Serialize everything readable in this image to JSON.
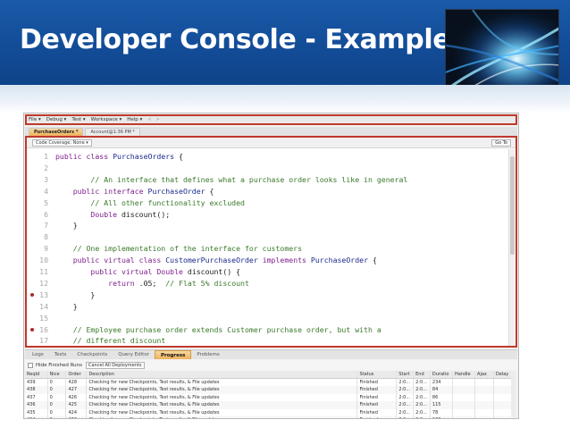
{
  "slide": {
    "title": "Developer Console - Example"
  },
  "colors": {
    "header_blue": "#124b96",
    "highlight_red": "#c0392b",
    "active_tab_orange": "#efb25c"
  },
  "menubar": {
    "items": [
      "File ▾",
      "Debug ▾",
      "Test ▾",
      "Workspace ▾",
      "Help ▾"
    ],
    "nav": [
      "<",
      ">"
    ]
  },
  "file_tabs": [
    "PurchaseOrders *",
    "Account@1:36 PM *"
  ],
  "editor": {
    "coverage": "Code Coverage: None ▾",
    "goto": "Go To",
    "lines": [
      {
        "n": "1",
        "marker": false,
        "parts": [
          [
            "kw",
            "public class "
          ],
          [
            "tp",
            "PurchaseOrders "
          ],
          [
            "pl",
            "{"
          ]
        ]
      },
      {
        "n": "2",
        "marker": false,
        "parts": []
      },
      {
        "n": "3",
        "marker": false,
        "parts": [
          [
            "cm",
            "        // An interface that defines what a purchase order looks like in general"
          ]
        ]
      },
      {
        "n": "4",
        "marker": false,
        "parts": [
          [
            "kw",
            "    public interface "
          ],
          [
            "tp",
            "PurchaseOrder "
          ],
          [
            "pl",
            "{"
          ]
        ]
      },
      {
        "n": "5",
        "marker": false,
        "parts": [
          [
            "cm",
            "        // All other functionality excluded"
          ]
        ]
      },
      {
        "n": "6",
        "marker": false,
        "parts": [
          [
            "kw",
            "        Double "
          ],
          [
            "pl",
            "discount();"
          ]
        ]
      },
      {
        "n": "7",
        "marker": false,
        "parts": [
          [
            "pl",
            "    }"
          ]
        ]
      },
      {
        "n": "8",
        "marker": false,
        "parts": []
      },
      {
        "n": "9",
        "marker": false,
        "parts": [
          [
            "cm",
            "    // One implementation of the interface for customers"
          ]
        ]
      },
      {
        "n": "10",
        "marker": false,
        "parts": [
          [
            "kw",
            "    public virtual class "
          ],
          [
            "tp",
            "CustomerPurchaseOrder "
          ],
          [
            "kw",
            "implements "
          ],
          [
            "tp",
            "PurchaseOrder "
          ],
          [
            "pl",
            "{"
          ]
        ]
      },
      {
        "n": "11",
        "marker": false,
        "parts": [
          [
            "kw",
            "        public virtual Double "
          ],
          [
            "pl",
            "discount() {"
          ]
        ]
      },
      {
        "n": "12",
        "marker": false,
        "parts": [
          [
            "kw",
            "            return "
          ],
          [
            "nm",
            ".05;  "
          ],
          [
            "cm",
            "// Flat 5% discount"
          ]
        ]
      },
      {
        "n": "13",
        "marker": true,
        "parts": [
          [
            "pl",
            "        }"
          ]
        ]
      },
      {
        "n": "14",
        "marker": false,
        "parts": [
          [
            "pl",
            "    }"
          ]
        ]
      },
      {
        "n": "15",
        "marker": false,
        "parts": []
      },
      {
        "n": "16",
        "marker": true,
        "parts": [
          [
            "cm",
            "    // Employee purchase order extends Customer purchase order, but with a"
          ]
        ]
      },
      {
        "n": "17",
        "marker": false,
        "parts": [
          [
            "cm",
            "    // different discount"
          ]
        ]
      }
    ]
  },
  "panel": {
    "tabs": [
      "Logs",
      "Tests",
      "Checkpoints",
      "Query Editor",
      "Progress",
      "Problems"
    ],
    "active_tab": "Progress",
    "hide_label": "Hide Finished Runs",
    "cancel_label": "Cancel All Deployments",
    "columns": [
      "ReqId",
      "Nice",
      "Order",
      "Description",
      "Status",
      "Start",
      "End",
      "Duratio",
      "Handle",
      "Ajax",
      "Delay"
    ],
    "rows": [
      [
        "439",
        "0",
        "428",
        "Checking for new Checkpoints, Test results, & File updates",
        "Finished",
        "2:0...",
        "2:0...",
        "234",
        "",
        "",
        ""
      ],
      [
        "438",
        "0",
        "427",
        "Checking for new Checkpoints, Test results, & File updates",
        "Finished",
        "2:0...",
        "2:0...",
        "84",
        "",
        "",
        ""
      ],
      [
        "437",
        "0",
        "426",
        "Checking for new Checkpoints, Test results, & File updates",
        "Finished",
        "2:0...",
        "2:0...",
        "86",
        "",
        "",
        ""
      ],
      [
        "436",
        "0",
        "425",
        "Checking for new Checkpoints, Test results, & File updates",
        "Finished",
        "2:0...",
        "2:0...",
        "115",
        "",
        "",
        ""
      ],
      [
        "435",
        "0",
        "424",
        "Checking for new Checkpoints, Test results, & File updates",
        "Finished",
        "2:0...",
        "2:0...",
        "78",
        "",
        "",
        ""
      ],
      [
        "434",
        "0",
        "423",
        "Checking for new Checkpoints, Test results, & File updates",
        "Finished",
        "2:0...",
        "2:0...",
        "103",
        "",
        "",
        ""
      ]
    ]
  }
}
